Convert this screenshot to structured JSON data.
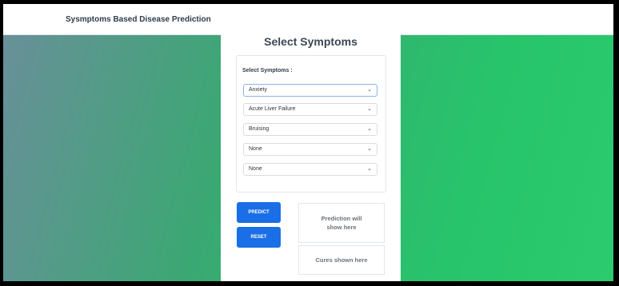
{
  "navbar": {
    "brand": "Sysmptoms Based Disease Prediction"
  },
  "card": {
    "title": "Select Symptoms"
  },
  "symptoms": {
    "label": "Select Symptoms :",
    "selects": [
      {
        "value": "Anxiety"
      },
      {
        "value": "Acute Liver Failure"
      },
      {
        "value": "Bruising"
      },
      {
        "value": "None"
      },
      {
        "value": "None"
      }
    ]
  },
  "actions": {
    "predict_label": "PREDICT",
    "reset_label": "RESET"
  },
  "results": {
    "prediction_placeholder": "Prediction will show here",
    "cures_placeholder": "Cures shown here"
  },
  "icons": {
    "select_arrow": "chevron-down-icon"
  },
  "colors": {
    "primary_button": "#1a6ee6",
    "background_gradient_start": "#6a8f9a",
    "background_gradient_end": "#2ccb6e"
  }
}
